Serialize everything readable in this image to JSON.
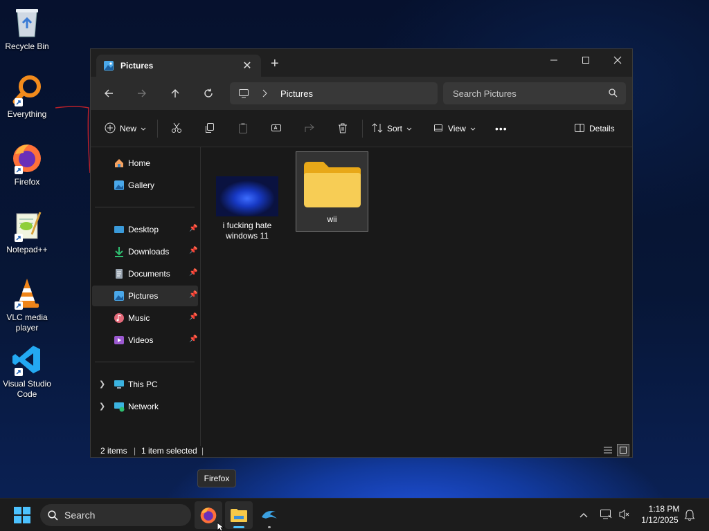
{
  "desktop": {
    "icons": [
      {
        "label": "Recycle Bin"
      },
      {
        "label": "Everything"
      },
      {
        "label": "Firefox"
      },
      {
        "label": "Notepad++"
      },
      {
        "label": "VLC media player"
      },
      {
        "label": "Visual Studio Code"
      }
    ]
  },
  "explorer": {
    "tab_title": "Pictures",
    "tab_close": "✕",
    "new_tab": "+",
    "address": "Pictures",
    "search_placeholder": "Search Pictures",
    "toolbar": {
      "new_label": "New",
      "sort_label": "Sort",
      "view_label": "View",
      "more_label": "•••",
      "details_label": "Details"
    },
    "sidebar": {
      "quick": [
        {
          "label": "Home"
        },
        {
          "label": "Gallery"
        }
      ],
      "pinned": [
        {
          "label": "Desktop"
        },
        {
          "label": "Downloads"
        },
        {
          "label": "Documents"
        },
        {
          "label": "Pictures"
        },
        {
          "label": "Music"
        },
        {
          "label": "Videos"
        }
      ],
      "locations": [
        {
          "label": "This PC"
        },
        {
          "label": "Network"
        }
      ]
    },
    "files": [
      {
        "name": "i fucking hate windows 11",
        "type": "image"
      },
      {
        "name": "wii",
        "type": "folder",
        "selected": true
      }
    ],
    "status": {
      "items": "2 items",
      "selected": "1 item selected"
    }
  },
  "tooltip": "Firefox",
  "taskbar": {
    "search_placeholder": "Search",
    "apps": [
      {
        "name": "firefox-icon"
      },
      {
        "name": "file-explorer-icon"
      },
      {
        "name": "dolphin-icon"
      }
    ],
    "time": "1:18 PM",
    "date": "1/12/2025"
  },
  "colors": {
    "accent": "#4cc2ff",
    "folder": "#f5c542",
    "selection": "#333333"
  }
}
